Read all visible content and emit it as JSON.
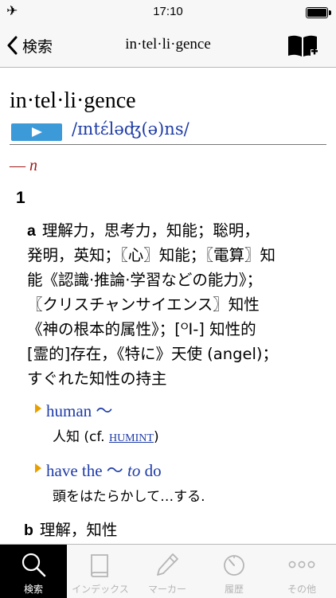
{
  "status": {
    "time": "17:10"
  },
  "nav": {
    "back_label": "検索",
    "title": "in·tel·li·gence"
  },
  "entry": {
    "headword": "in·tel·li·gence",
    "pronunciation": "/ɪntέləʤ(ə)ns/",
    "pos_dash": "—",
    "pos": "n",
    "sense_number": "1",
    "senses": {
      "a": {
        "letter": "a",
        "lines": [
          "理解力，思考力，知能；聡明，",
          "発明，英知；〖心〗知能；〖電算〗知",
          "能《認識·推論·学習などの能力》；",
          "〖クリスチャンサイエンス〗知性",
          "《神の根本的属性》；[ᴼI-] 知性的",
          "[霊的]存在，《特に》天使 (angel)；",
          "すぐれた知性の持主"
        ]
      },
      "b": {
        "letter": "b",
        "text": "理解，知性"
      }
    },
    "phrases": [
      {
        "phrase_before": "human ～",
        "phrase_italic": "",
        "phrase_after": "",
        "translation_before": "人知 (cf. ",
        "link": "HUMINT",
        "translation_after": ")"
      },
      {
        "phrase_before": "have the ～ ",
        "phrase_italic": "to",
        "phrase_after": " do",
        "translation_before": "頭をはたらかして…する.",
        "link": "",
        "translation_after": ""
      }
    ]
  },
  "tabs": [
    {
      "label": "検索",
      "icon": "search-icon",
      "active": true
    },
    {
      "label": "インデックス",
      "icon": "book-icon",
      "active": false
    },
    {
      "label": "マーカー",
      "icon": "pen-icon",
      "active": false
    },
    {
      "label": "履歴",
      "icon": "history-icon",
      "active": false
    },
    {
      "label": "その他",
      "icon": "more-icon",
      "active": false
    }
  ],
  "colors": {
    "accent": "#3d9ad9",
    "link": "#1e3ca8",
    "pos": "#a01818",
    "marker": "#e8a000"
  }
}
